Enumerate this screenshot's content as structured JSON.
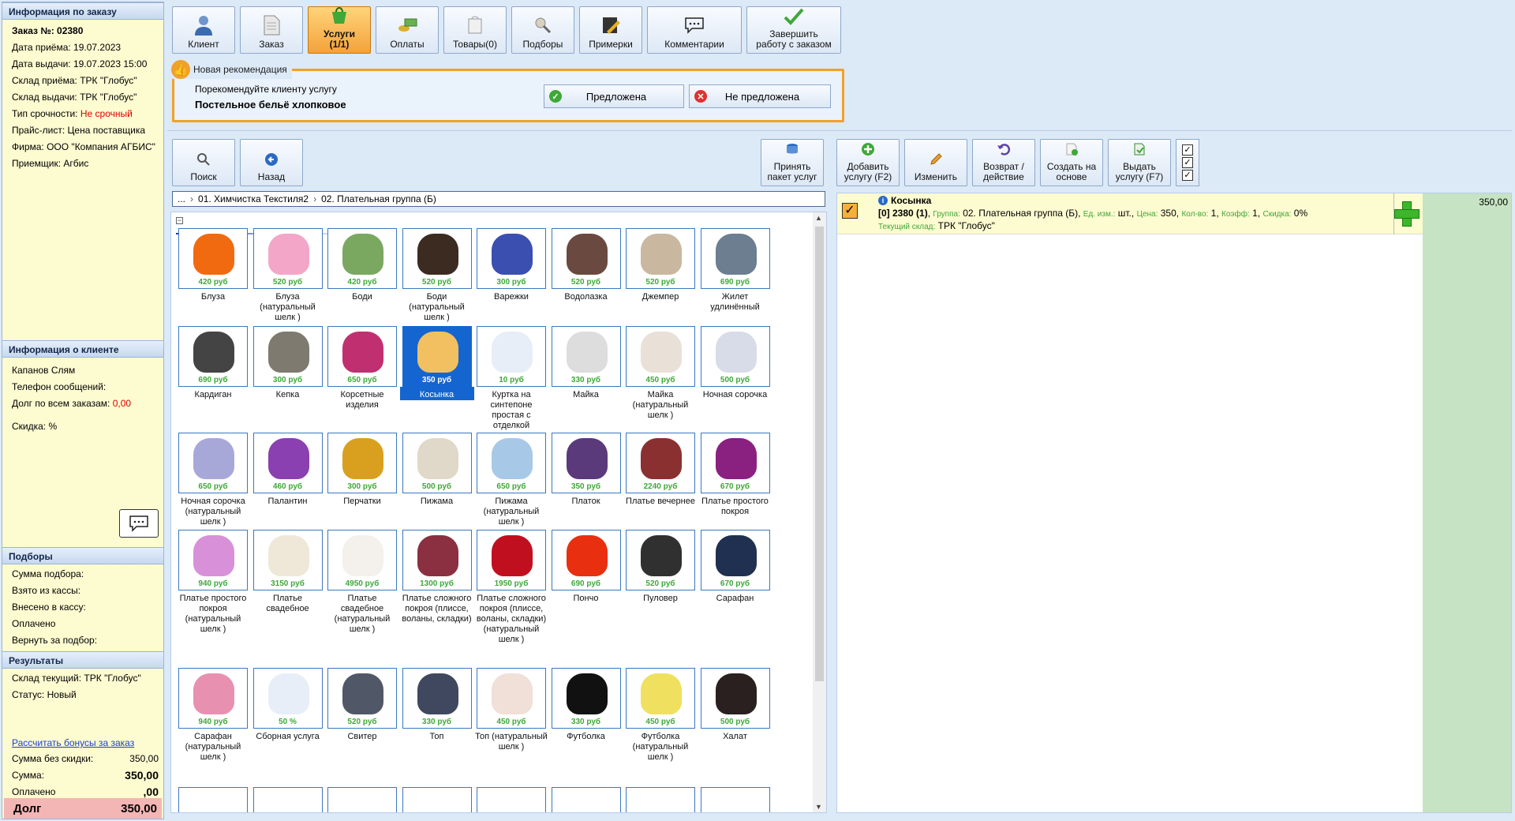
{
  "order_info": {
    "header": "Информация по заказу",
    "order_no": "Заказ №: 02380",
    "receive_date": "Дата приёма: 19.07.2023",
    "issue_date": "Дата выдачи: 19.07.2023 15:00",
    "receive_store": "Склад приёма: ТРК \"Глобус\"",
    "issue_store": "Склад выдачи: ТРК \"Глобус\"",
    "urgency_label": "Тип срочности: ",
    "urgency_value": "Не срочный",
    "price_list": "Прайс-лист: Цена поставщика",
    "firm": "Фирма: ООО \"Компания АГБИС\"",
    "receiver": "Приемщик: Агбис"
  },
  "client_info": {
    "header": "Информация о клиенте",
    "name": "Капанов Слям",
    "phone": "Телефон сообщений:",
    "debt_label": "Долг по всем заказам: ",
    "debt_value": "0,00",
    "discount": "Скидка: %"
  },
  "selections": {
    "header": "Подборы",
    "lines": [
      "Сумма подбора:",
      "Взято из кассы:",
      "Внесено в кассу:",
      "Оплачено",
      "Вернуть за подбор:"
    ]
  },
  "results": {
    "header": "Результаты",
    "store": "Склад текущий: ТРК \"Глобус\"",
    "status": "Статус: Новый",
    "bonus_link": "Рассчитать бонусы за заказ",
    "sum_no_discount_label": "Сумма без скидки:",
    "sum_no_discount": "350,00",
    "sum_label": "Сумма:",
    "sum": "350,00",
    "paid_label": "Оплачено",
    "paid": ",00",
    "debt_label": "Долг",
    "debt": "350,00"
  },
  "toolbar": {
    "client": "Клиент",
    "order": "Заказ",
    "services": "Услуги\n(1/1)",
    "payments": "Оплаты",
    "goods": "Товары(0)",
    "selections": "Подборы",
    "fittings": "Примерки",
    "comments": "Комментарии",
    "finish": "Завершить работу с заказом"
  },
  "recommendation": {
    "title": "Новая рекомендация",
    "subtitle": "Порекомендуйте клиенту услугу",
    "service": "Постельное бельё хлопковое",
    "offered": "Предложена",
    "not_offered": "Не предложена"
  },
  "catalog_toolbar": {
    "search": "Поиск",
    "back": "Назад",
    "accept_package": "Принять пакет услуг",
    "add_service": "Добавить услугу (F2)",
    "edit": "Изменить",
    "return_action": "Возврат / действие",
    "create_based": "Создать на основе",
    "issue_service": "Выдать услугу (F7)"
  },
  "breadcrumb": [
    "...",
    "01. Химчистка Текстиля2",
    "02. Плательная группа (Б)"
  ],
  "catalog_items": [
    {
      "label": "Блуза",
      "price": "420 руб",
      "color": "#f26a10"
    },
    {
      "label": "Блуза (натуральный шелк )",
      "price": "520 руб",
      "color": "#f3a6c8"
    },
    {
      "label": "Боди",
      "price": "420 руб",
      "color": "#7aa860"
    },
    {
      "label": "Боди (натуральный шелк )",
      "price": "520 руб",
      "color": "#3b2b20"
    },
    {
      "label": "Варежки",
      "price": "300 руб",
      "color": "#3a4fb0"
    },
    {
      "label": "Водолазка",
      "price": "520 руб",
      "color": "#6a4a40"
    },
    {
      "label": "Джемпер",
      "price": "520 руб",
      "color": "#c9b7a0"
    },
    {
      "label": "Жилет удлинённый",
      "price": "690 руб",
      "color": "#6c7e90"
    },
    {
      "label": "Кардиган",
      "price": "690 руб",
      "color": "#444444"
    },
    {
      "label": "Кепка",
      "price": "300 руб",
      "color": "#7e7a70"
    },
    {
      "label": "Корсетные изделия",
      "price": "650 руб",
      "color": "#c03070"
    },
    {
      "label": "Косынка",
      "price": "350 руб",
      "color": "#f2c060",
      "selected": true
    },
    {
      "label": "Куртка на синтепоне простая с отделкой",
      "price": "10 руб",
      "color": "#e8eef8"
    },
    {
      "label": "Майка",
      "price": "330 руб",
      "color": "#dddddd"
    },
    {
      "label": "Майка (натуральный шелк )",
      "price": "450 руб",
      "color": "#e9e0d8"
    },
    {
      "label": "Ночная сорочка",
      "price": "500 руб",
      "color": "#d8dce8"
    },
    {
      "label": "Ночная сорочка (натуральный шелк )",
      "price": "650 руб",
      "color": "#a8a8d8"
    },
    {
      "label": "Палантин",
      "price": "460 руб",
      "color": "#8a40b0"
    },
    {
      "label": "Перчатки",
      "price": "300 руб",
      "color": "#d9a020"
    },
    {
      "label": "Пижама",
      "price": "500 руб",
      "color": "#e0d8c8"
    },
    {
      "label": "Пижама (натуральный шелк )",
      "price": "650 руб",
      "color": "#a8c8e8"
    },
    {
      "label": "Платок",
      "price": "350 руб",
      "color": "#5a3a7a"
    },
    {
      "label": "Платье вечернее",
      "price": "2240 руб",
      "color": "#8a3030"
    },
    {
      "label": "Платье простого покроя",
      "price": "670 руб",
      "color": "#8a2080"
    },
    {
      "label": "Платье простого покроя (натуральный шелк )",
      "price": "940 руб",
      "color": "#d890d8"
    },
    {
      "label": "Платье свадебное",
      "price": "3150 руб",
      "color": "#efe8d8"
    },
    {
      "label": "Платье свадебное (натуральный шелк )",
      "price": "4950 руб",
      "color": "#f4f0ec"
    },
    {
      "label": "Платье сложного покроя (плиссе, воланы, складки)",
      "price": "1300 руб",
      "color": "#8a3040"
    },
    {
      "label": "Платье сложного покроя (плиссе, воланы, складки) (натуральный шелк )",
      "price": "1950 руб",
      "color": "#c01020"
    },
    {
      "label": "Пончо",
      "price": "690 руб",
      "color": "#e83010"
    },
    {
      "label": "Пуловер",
      "price": "520 руб",
      "color": "#303030"
    },
    {
      "label": "Сарафан",
      "price": "670 руб",
      "color": "#203050"
    },
    {
      "label": "Сарафан (натуральный шелк )",
      "price": "940 руб",
      "color": "#e890b0"
    },
    {
      "label": "Сборная услуга",
      "price": "50 %",
      "color": "#e8eef8"
    },
    {
      "label": "Свитер",
      "price": "520 руб",
      "color": "#505868"
    },
    {
      "label": "Топ",
      "price": "330 руб",
      "color": "#404860"
    },
    {
      "label": "Топ (натуральный шелк )",
      "price": "450 руб",
      "color": "#f0e0d8"
    },
    {
      "label": "Футболка",
      "price": "330 руб",
      "color": "#111111"
    },
    {
      "label": "Футболка (натуральный шелк )",
      "price": "450 руб",
      "color": "#f0e060"
    },
    {
      "label": "Халат",
      "price": "500 руб",
      "color": "#2a2020"
    }
  ],
  "order_item": {
    "title": "Косынка",
    "line1_code": "[0] 2380 (1)",
    "group_label": "Группа:",
    "group": "02. Плательная группа (Б)",
    "unit_label": "Ед. изм.:",
    "unit": "шт.",
    "price_label": "Цена:",
    "price": "350",
    "qty_label": "Кол-во:",
    "qty": "1",
    "coef_label": "Коэфф:",
    "coef": "1",
    "discount_label": "Скидка:",
    "discount": "0%",
    "store_label": "Текущий склад:",
    "store": "ТРК \"Глобус\"",
    "total": "350,00"
  },
  "colors": {
    "accent_orange": "#f0a228",
    "sidebar_bg": "#fdfbd0",
    "price_green": "#3ea838",
    "debt_red": "#e00000"
  }
}
